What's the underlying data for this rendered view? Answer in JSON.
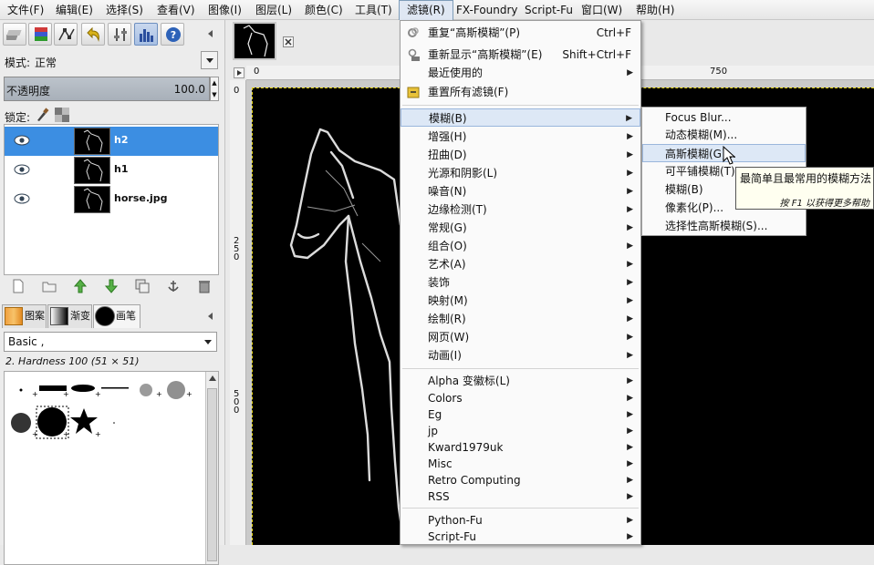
{
  "menubar": {
    "items": [
      "文件(F)",
      "编辑(E)",
      "选择(S)",
      "查看(V)",
      "图像(I)",
      "图层(L)",
      "颜色(C)",
      "工具(T)",
      "滤镜(R)",
      "FX-Foundry",
      "Script-Fu",
      "窗口(W)",
      "帮助(H)"
    ]
  },
  "layers_panel": {
    "mode_label": "模式:",
    "mode_value": "正常",
    "opacity_label": "不透明度",
    "opacity_value": "100.0",
    "lock_label": "锁定:",
    "layers": [
      {
        "name": "h2",
        "selected": true
      },
      {
        "name": "h1",
        "selected": false
      },
      {
        "name": "horse.jpg",
        "selected": false
      }
    ]
  },
  "brushes_panel": {
    "tabs": [
      "图案",
      "渐变",
      "画笔"
    ],
    "preset_value": "Basic ,",
    "brush_info": "2. Hardness 100 (51 × 51)"
  },
  "rulers": {
    "top_ticks": [
      "0",
      "750"
    ],
    "left_ticks": [
      "0",
      "2\n5\n0",
      "5\n0\n0"
    ]
  },
  "filters_menu": {
    "repeat_label": "重复“高斯模糊”(P)",
    "repeat_shortcut": "Ctrl+F",
    "reshow_label": "重新显示“高斯模糊”(E)",
    "reshow_shortcut": "Shift+Ctrl+F",
    "recent_label": "最近使用的",
    "reset_label": "重置所有滤镜(F)",
    "group1": [
      "模糊(B)",
      "增强(H)",
      "扭曲(D)",
      "光源和阴影(L)",
      "噪音(N)",
      "边缘检测(T)",
      "常规(G)",
      "组合(O)",
      "艺术(A)",
      "装饰",
      "映射(M)",
      "绘制(R)",
      "网页(W)",
      "动画(I)"
    ],
    "group2": [
      "Alpha 变徽标(L)",
      "Colors",
      "Eg",
      "jp",
      "Kward1979uk",
      "Misc",
      "Retro Computing",
      "RSS"
    ],
    "group3": [
      "Python-Fu",
      "Script-Fu"
    ]
  },
  "blur_submenu": {
    "items": [
      "Focus Blur...",
      "动态模糊(M)...",
      "高斯模糊(G)...",
      "可平铺模糊(T)",
      "模糊(B)",
      "像素化(P)...",
      "选择性高斯模糊(S)..."
    ]
  },
  "tooltip": {
    "text": "最简单且最常用的模糊方法",
    "hint": "按 F1 以获得更多帮助"
  }
}
